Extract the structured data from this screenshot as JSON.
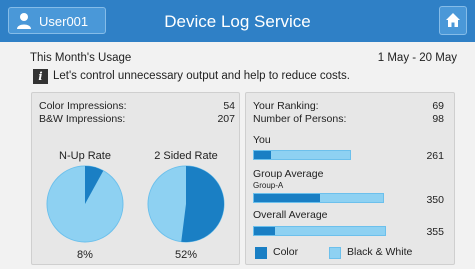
{
  "header": {
    "user_label": "User001",
    "title": "Device Log Service"
  },
  "usage": {
    "label": "This Month's Usage",
    "period": "1 May - 20 May"
  },
  "notice": {
    "icon": "info-icon",
    "text": "Let's control unnecessary output and help to reduce costs."
  },
  "impressions": {
    "color_label": "Color Impressions:",
    "color_value": "54",
    "bw_label": "B&W Impressions:",
    "bw_value": "207"
  },
  "rates": {
    "nup_title": "N-Up Rate",
    "nup_value": 8,
    "nup_text": "8%",
    "sided_title": "2 Sided Rate",
    "sided_value": 52,
    "sided_text": "52%"
  },
  "ranking": {
    "rank_label": "Your Ranking:",
    "rank_value": "69",
    "persons_label": "Number of Persons:",
    "persons_value": "98"
  },
  "bars": {
    "max": 400,
    "you": {
      "label": "You",
      "total": 261,
      "total_text": "261",
      "color": 44
    },
    "group": {
      "label": "Group Average",
      "sub": "Group-A",
      "total": 350,
      "total_text": "350",
      "color": 175
    },
    "overall": {
      "label": "Overall Average",
      "total": 355,
      "total_text": "355",
      "color": 57
    }
  },
  "legend": {
    "color_label": "Color",
    "bw_label": "Black & White"
  },
  "colors": {
    "header": "#2f80c6",
    "color_series": "#1a7fc4",
    "bw_series": "#8ed1f2"
  }
}
